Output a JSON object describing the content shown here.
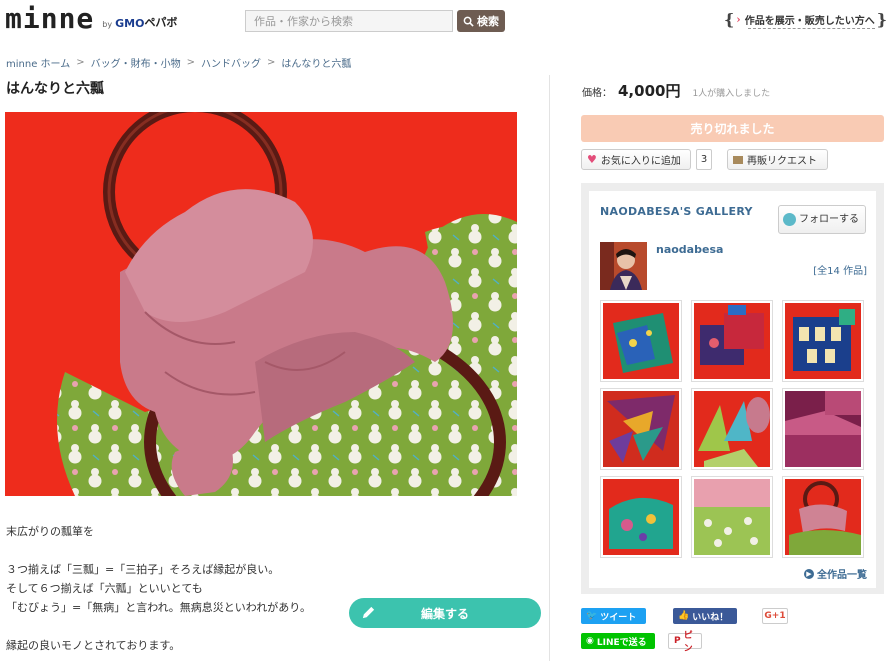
{
  "header": {
    "logo": "minne",
    "by": "by",
    "gmo": "GMO",
    "pepabo": "ペパボ",
    "search_placeholder": "作品・作家から検索",
    "search_button": "検索",
    "sell_link": "作品を展示・販売したい方へ"
  },
  "breadcrumb": [
    "minne ホーム",
    "バッグ・財布・小物",
    "ハンドバッグ",
    "はんなりと六瓢"
  ],
  "breadcrumb_sep": ">",
  "product": {
    "title": "はんなりと六瓢",
    "description": [
      "末広がりの瓢箪を",
      "",
      "３つ揃えば「三瓢」=「三拍子」そろえば縁起が良い。",
      "そして６つ揃えば「六瓢」といいとても",
      "「むびょう」=「無病」と言われ。無病息災といわれがあり。",
      "",
      "縁起の良いモノとされております。"
    ],
    "edit_button": "編集する"
  },
  "purchase": {
    "price_label": "価格：",
    "price": "4,000円",
    "purchased_text": "1人が購入しました",
    "soldout_label": "売り切れました",
    "favorite_label": "お気に入りに追加",
    "favorite_count": "3",
    "restock_label": "再販リクエスト"
  },
  "gallery": {
    "title": "NAODABESA'S GALLERY",
    "follow_label": "フォローする",
    "username": "naodabesa",
    "count_text": "[全14 作品]",
    "all_link": "全作品一覧"
  },
  "social": {
    "tweet": "ツイート",
    "like": "いいね！",
    "gplus": "G+1",
    "line": "LINEで送る",
    "pin": "ピン"
  },
  "colors": {
    "accent_teal": "#3cc3ae",
    "soldout_peach": "#f9cbb4",
    "link_blue": "#3d6b93",
    "search_brown": "#6e5c52"
  }
}
